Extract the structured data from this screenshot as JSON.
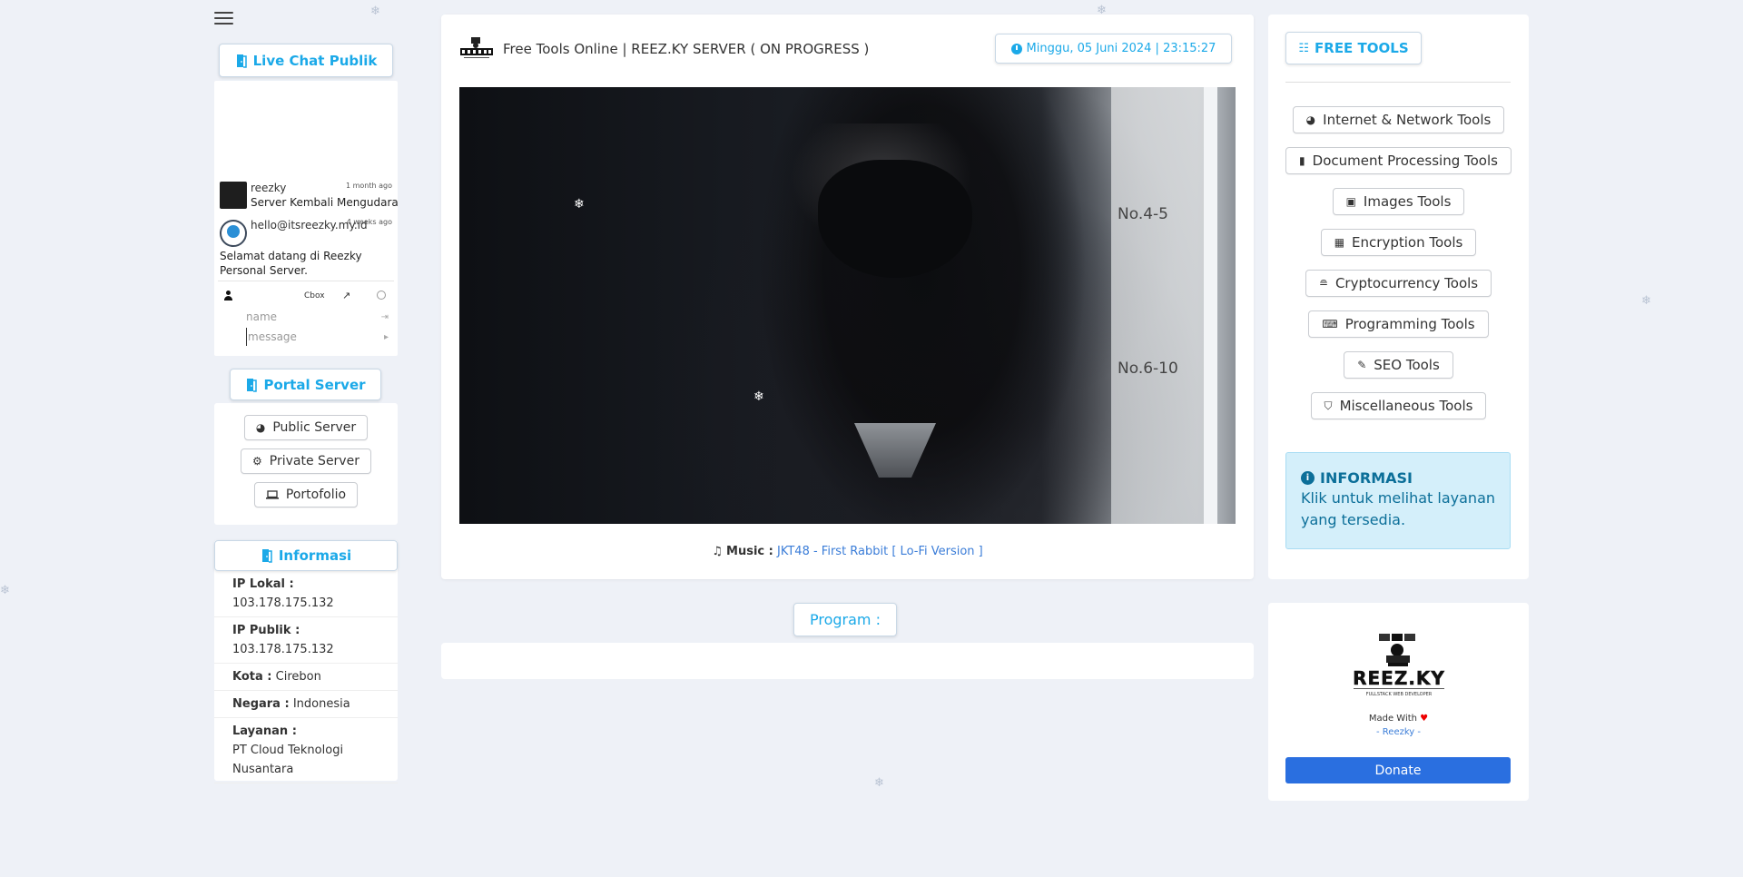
{
  "livechat": {
    "title": "Live Chat Publik",
    "messages": [
      {
        "name": "reezky",
        "time": "1 month ago",
        "text": "Server Kembali Mengudara"
      },
      {
        "name": "hello@itsreezky.my.id",
        "time": "4 weeks ago",
        "text": "Selamat datang di Reezky Personal Server."
      }
    ],
    "cbox_label": "Cbox",
    "name_placeholder": "name",
    "message_placeholder": "message"
  },
  "portal": {
    "title": "Portal Server",
    "items": [
      {
        "label": "Public Server",
        "icon": "globe-icon"
      },
      {
        "label": "Private Server",
        "icon": "gear-icon"
      },
      {
        "label": "Portofolio",
        "icon": "laptop-icon"
      }
    ]
  },
  "informasi": {
    "title": "Informasi",
    "rows": [
      {
        "label": "IP Lokal :",
        "value": "103.178.175.132"
      },
      {
        "label": "IP Publik :",
        "value": "103.178.175.132"
      },
      {
        "label": "Kota :",
        "value": "Cirebon"
      },
      {
        "label": "Negara :",
        "value": "Indonesia"
      },
      {
        "label": "Layanan :",
        "value": "PT Cloud Teknologi Nusantara"
      }
    ]
  },
  "main": {
    "title": "Free Tools Online | REEZ.KY SERVER ( ON PROGRESS )",
    "datetime": "Minggu, 05 Juni 2024 |  23:15:27",
    "music_label": "Music :",
    "music_track": "JKT48 - First Rabbit [ Lo-Fi Version ]",
    "video_labels": [
      "No.4-5",
      "No.6-10"
    ],
    "program_label": "Program :"
  },
  "tools": {
    "title": "FREE TOOLS",
    "items": [
      {
        "label": "Internet & Network Tools",
        "icon": "globe-icon"
      },
      {
        "label": "Document Processing Tools",
        "icon": "file-icon"
      },
      {
        "label": "Images Tools",
        "icon": "image-icon"
      },
      {
        "label": "Encryption Tools",
        "icon": "encryption-icon"
      },
      {
        "label": "Cryptocurrency Tools",
        "icon": "coins-icon"
      },
      {
        "label": "Programming Tools",
        "icon": "laptop-code-icon"
      },
      {
        "label": "SEO Tools",
        "icon": "wrench-icon"
      },
      {
        "label": "Miscellaneous Tools",
        "icon": "shield-icon"
      }
    ],
    "alert_title": "INFORMASI",
    "alert_text": "Klik untuk melihat layanan yang tersedia."
  },
  "brand": {
    "logo_text": "REEZ.KY",
    "logo_subtitle": "FULLSTACK WEB DEVELOPER",
    "made_with": "Made With",
    "author": "- Reezky -",
    "donate": "Donate"
  },
  "colors": {
    "accent": "#1ba9e8",
    "link": "#3b7dd8",
    "donate": "#2a6fe0",
    "background": "#eef1f7",
    "alert_bg": "#d4effa"
  }
}
